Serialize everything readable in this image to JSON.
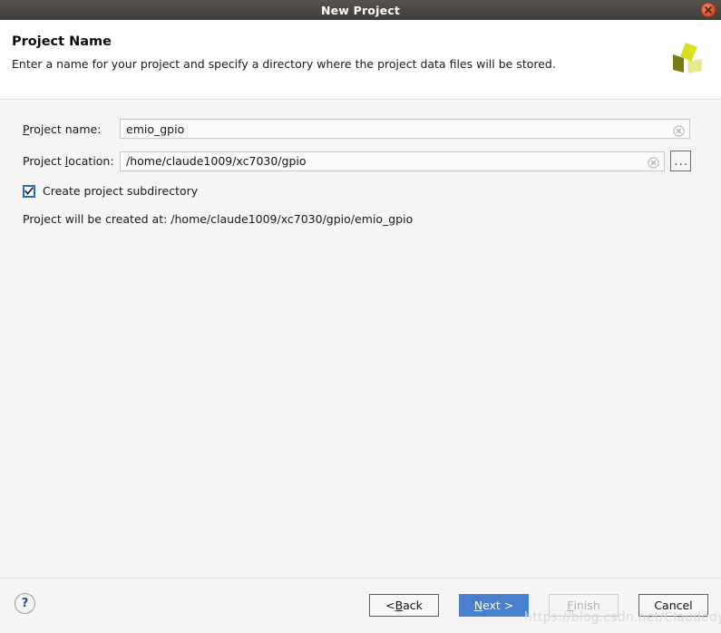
{
  "window": {
    "title": "New Project",
    "close_icon": "close-icon"
  },
  "header": {
    "title": "Project Name",
    "description": "Enter a name for your project and specify a directory where the project data files will be stored.",
    "logo_icon": "xilinx-vivado-logo-icon",
    "logo_colors": {
      "top_blade": "#d9e021",
      "left_blade": "#7a7a15",
      "right_blade": "#e6ea8c"
    }
  },
  "form": {
    "project_name": {
      "label_prefix": "",
      "label_accel": "P",
      "label_rest": "roject name:",
      "label_full": "Project name:",
      "value": "emio_gpio",
      "placeholder": "",
      "clear_icon": "clear-circle-icon"
    },
    "project_location": {
      "label_accel_pre": "Project ",
      "label_accel": "l",
      "label_rest": "ocation:",
      "label_full": "Project location:",
      "value": "/home/claude1009/xc7030/gpio",
      "placeholder": "",
      "clear_icon": "clear-circle-icon",
      "browse_label": "...",
      "browse_icon": "ellipsis-icon"
    },
    "create_subdirectory": {
      "label": "Create project subdirectory",
      "checked": true,
      "check_icon": "checkmark-icon"
    },
    "created_at_text": "Project will be created at: /home/claude1009/xc7030/gpio/emio_gpio"
  },
  "footer": {
    "help_icon": "question-mark-icon",
    "help_label": "?",
    "buttons": [
      {
        "name": "back",
        "pre": "< ",
        "accel": "B",
        "post": "ack",
        "full": "< Back",
        "state": "enabled",
        "primary": false
      },
      {
        "name": "next",
        "pre": "",
        "accel": "N",
        "post": "ext >",
        "full": "Next >",
        "state": "enabled",
        "primary": true
      },
      {
        "name": "finish",
        "pre": "",
        "accel": "F",
        "post": "inish",
        "full": "Finish",
        "state": "disabled",
        "primary": false
      },
      {
        "name": "cancel",
        "pre": "",
        "accel": "",
        "post": "Cancel",
        "full": "Cancel",
        "state": "enabled",
        "primary": false
      }
    ]
  },
  "watermark": {
    "text": "https://blog.csdn.net/Claudedy"
  },
  "colors": {
    "titlebar": "#4a4641",
    "accent_blue": "#4a7fd0",
    "checkbox_blue": "#2a6cc4",
    "body_bg": "#f5f5f5",
    "header_bg": "#ffffff",
    "close_red": "#e4613b"
  }
}
